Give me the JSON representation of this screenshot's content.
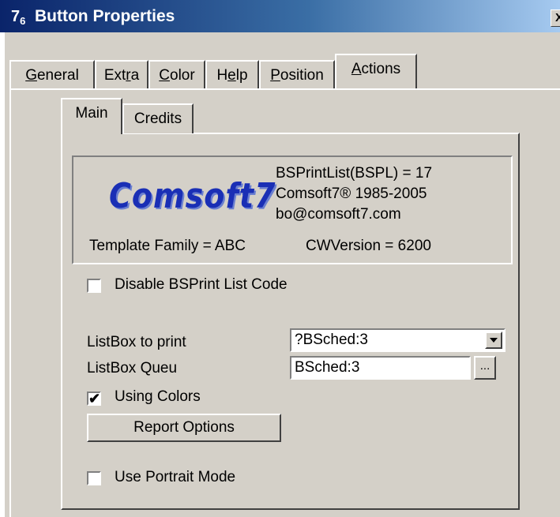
{
  "window": {
    "title": "Button Properties",
    "icon_text": "7",
    "icon_sub": "6",
    "close_label": "X"
  },
  "tabs": [
    {
      "label": "General",
      "access": "G",
      "rest": "eneral"
    },
    {
      "label": "Extra",
      "pre": "Ext",
      "access": "r",
      "rest": "a"
    },
    {
      "label": "Color",
      "access": "C",
      "rest": "olor"
    },
    {
      "label": "Help",
      "pre": "H",
      "access": "e",
      "rest": "lp"
    },
    {
      "label": "Position",
      "access": "P",
      "rest": "osition"
    },
    {
      "label": "Actions",
      "access": "A",
      "rest": "ctions",
      "active": true
    }
  ],
  "inner_tabs": [
    {
      "label": "Main",
      "active": true
    },
    {
      "label": "Credits"
    }
  ],
  "credits": {
    "logo": "Comsoft7",
    "line1": "BSPrintList(BSPL) = 17",
    "line2": "Comsoft7® 1985-2005",
    "line3": "bo@comsoft7.com",
    "template_family": "Template Family = ABC",
    "cw_version": "CWVersion = 6200"
  },
  "form": {
    "disable_label": "Disable BSPrint List Code",
    "disable_checked": "",
    "listbox_label": "ListBox to print",
    "listbox_value": "?BSched:3",
    "queue_label": "ListBox Queu",
    "queue_value": "BSched:3",
    "ellipsis_label": "...",
    "colors_label": "Using Colors",
    "colors_checked": "✔",
    "report_button": "Report Options",
    "portrait_label": "Use Portrait Mode",
    "portrait_checked": ""
  },
  "colors": {
    "title_start": "#0a246a",
    "title_end": "#a6caf0",
    "face": "#d4d0c8",
    "logo": "#1a2fb5"
  }
}
